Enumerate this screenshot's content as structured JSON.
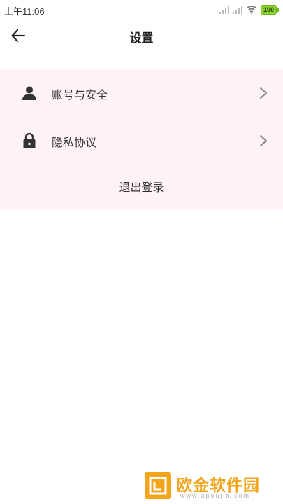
{
  "status_bar": {
    "time": "上午11:06",
    "battery": "100",
    "icons": [
      "signal-icon",
      "signal-icon",
      "wifi-icon",
      "battery-icon"
    ],
    "battery_color": "#8bd130"
  },
  "header": {
    "title": "设置",
    "back_icon": "arrow-left-icon"
  },
  "settings": {
    "background_color": "#fff3f6",
    "items": [
      {
        "label": "账号与安全",
        "icon": "person-icon",
        "trailing_icon": "chevron-right-icon"
      },
      {
        "label": "隐私协议",
        "icon": "lock-icon",
        "trailing_icon": "chevron-right-icon"
      }
    ],
    "logout_label": "退出登录"
  },
  "watermark": {
    "name": "欧金软件园",
    "url": "www.apoujin.com",
    "color": "#f2a51c"
  }
}
